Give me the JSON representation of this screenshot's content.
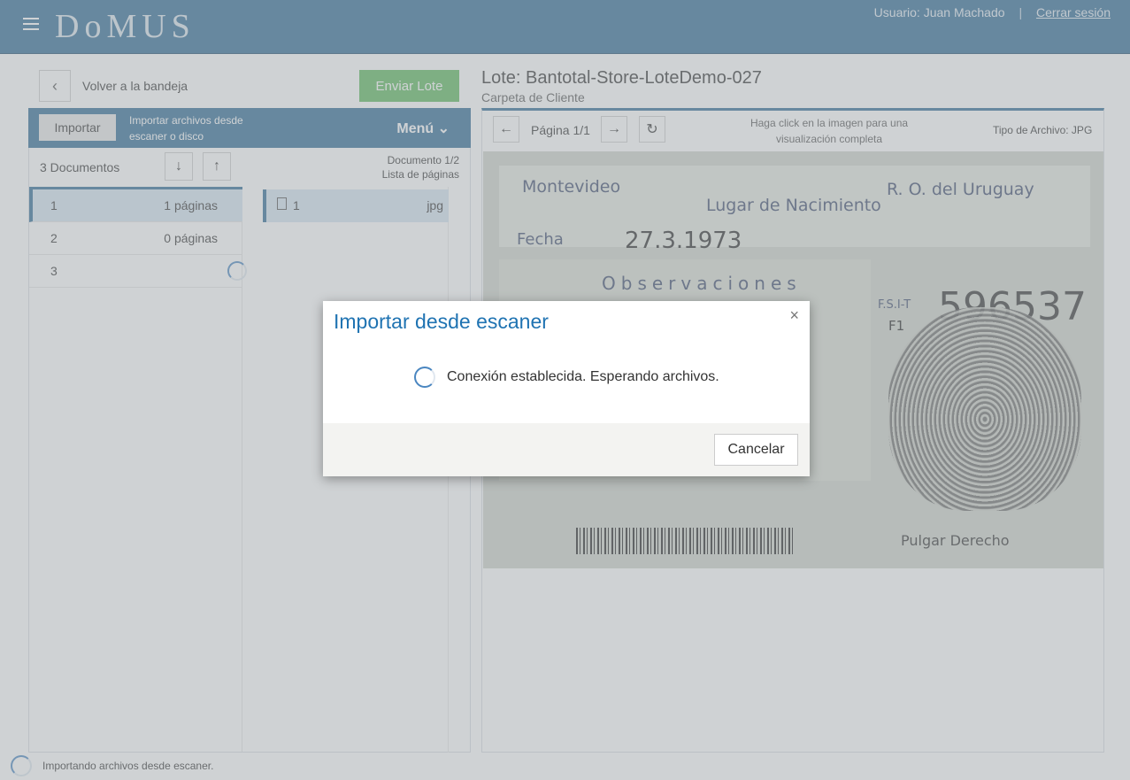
{
  "header": {
    "logo": "DoMUS",
    "user_label": "Usuario: Juan Machado",
    "separator": "|",
    "logout_label": "Cerrar sesión"
  },
  "toolbar": {
    "back_label": "Volver a la bandeja",
    "send_label": "Enviar Lote"
  },
  "import_bar": {
    "import_label": "Importar",
    "import_hint": "Importar archivos desde escaner o disco",
    "menu_label": "Menú"
  },
  "documents": {
    "count_label": "3 Documentos",
    "doc_index_label": "Documento 1/2",
    "pages_list_label": "Lista de páginas",
    "items": [
      {
        "num": "1",
        "pages": "1 páginas"
      },
      {
        "num": "2",
        "pages": "0 páginas"
      },
      {
        "num": "3",
        "pages": ""
      }
    ]
  },
  "pages": {
    "items": [
      {
        "name": "1",
        "type": "jpg"
      }
    ]
  },
  "viewer": {
    "lote_title": "Lote: Bantotal-Store-LoteDemo-027",
    "lote_subtitle": "Carpeta de Cliente",
    "page_indicator": "Página 1/1",
    "click_hint": "Haga click en la imagen para una visualización completa",
    "file_type": "Tipo de Archivo: JPG"
  },
  "id_card": {
    "city": "Montevideo",
    "country": "R. O. del Uruguay",
    "birthplace_label": "Lugar de Nacimiento",
    "date_label": "Fecha",
    "date_value": "27.3.1973",
    "observations": "Observaciones",
    "fsi_label": "F.S.I-T",
    "f_label": "F1",
    "fsi_number": "596537",
    "thumb_label": "Pulgar Derecho"
  },
  "footer": {
    "status": "Importando archivos desde escaner."
  },
  "modal": {
    "title": "Importar desde escaner",
    "close_symbol": "×",
    "message": "Conexión establecida. Esperando archivos.",
    "cancel_label": "Cancelar"
  }
}
